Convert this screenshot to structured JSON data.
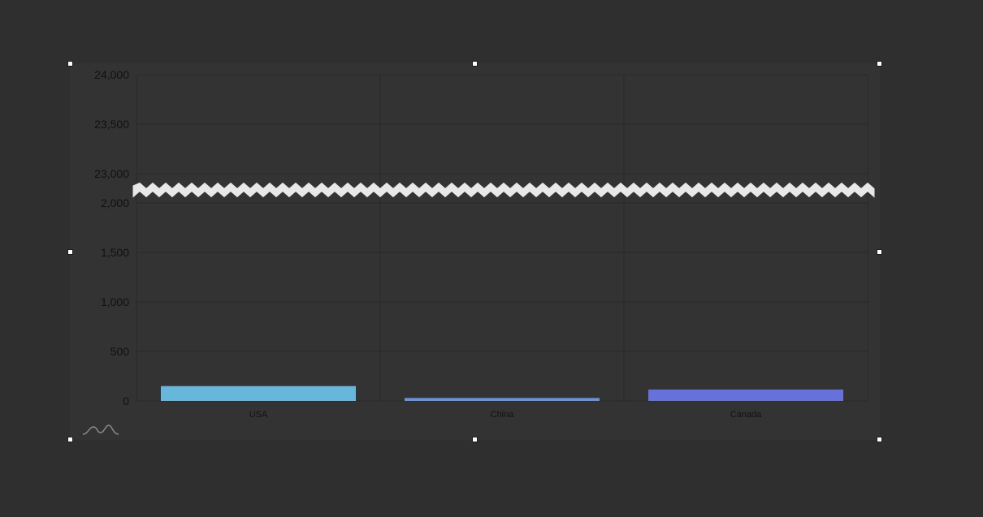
{
  "chart_data": {
    "type": "bar",
    "categories": [
      "USA",
      "China",
      "Canada"
    ],
    "values": [
      150,
      30,
      115
    ],
    "y_axis_break": {
      "lower_range": [
        0,
        2000
      ],
      "upper_range": [
        23000,
        24000
      ]
    },
    "y_ticks_lower": [
      0,
      500,
      1000,
      1500,
      2000
    ],
    "y_ticks_upper": [
      23000,
      23500,
      24000
    ],
    "y_tick_labels_lower": [
      "0",
      "500",
      "1,000",
      "1,500",
      "2,000"
    ],
    "y_tick_labels_upper": [
      "23,000",
      "23,500",
      "24,000"
    ],
    "colors": [
      "#67b7dc",
      "#6794dc",
      "#6771dc"
    ],
    "grid": true,
    "title": "",
    "xlabel": "",
    "ylabel": ""
  }
}
